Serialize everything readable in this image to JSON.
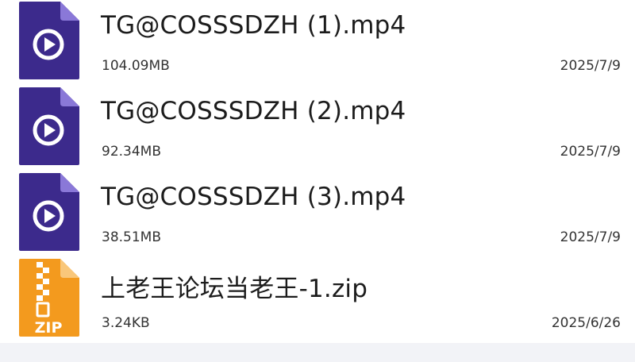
{
  "files": [
    {
      "name": "TG@COSSSDZH (1).mp4",
      "size": "104.09MB",
      "date": "2025/7/9",
      "icon": "video-file-icon"
    },
    {
      "name": "TG@COSSSDZH (2).mp4",
      "size": "92.34MB",
      "date": "2025/7/9",
      "icon": "video-file-icon"
    },
    {
      "name": "TG@COSSSDZH (3).mp4",
      "size": "38.51MB",
      "date": "2025/7/9",
      "icon": "video-file-icon"
    },
    {
      "name": "上老王论坛当老王-1.zip",
      "size": "3.24KB",
      "date": "2025/6/26",
      "icon": "zip-file-icon",
      "icon_label": "ZIP"
    }
  ],
  "colors": {
    "video_icon": "#3c2a8c",
    "video_icon_fold": "#8a78d8",
    "zip_icon": "#f39a1e",
    "zip_icon_fold": "#f9c77a",
    "text_primary": "#1c1c1c",
    "text_secondary": "#333333",
    "bottom_strip": "#f2f3f7"
  }
}
